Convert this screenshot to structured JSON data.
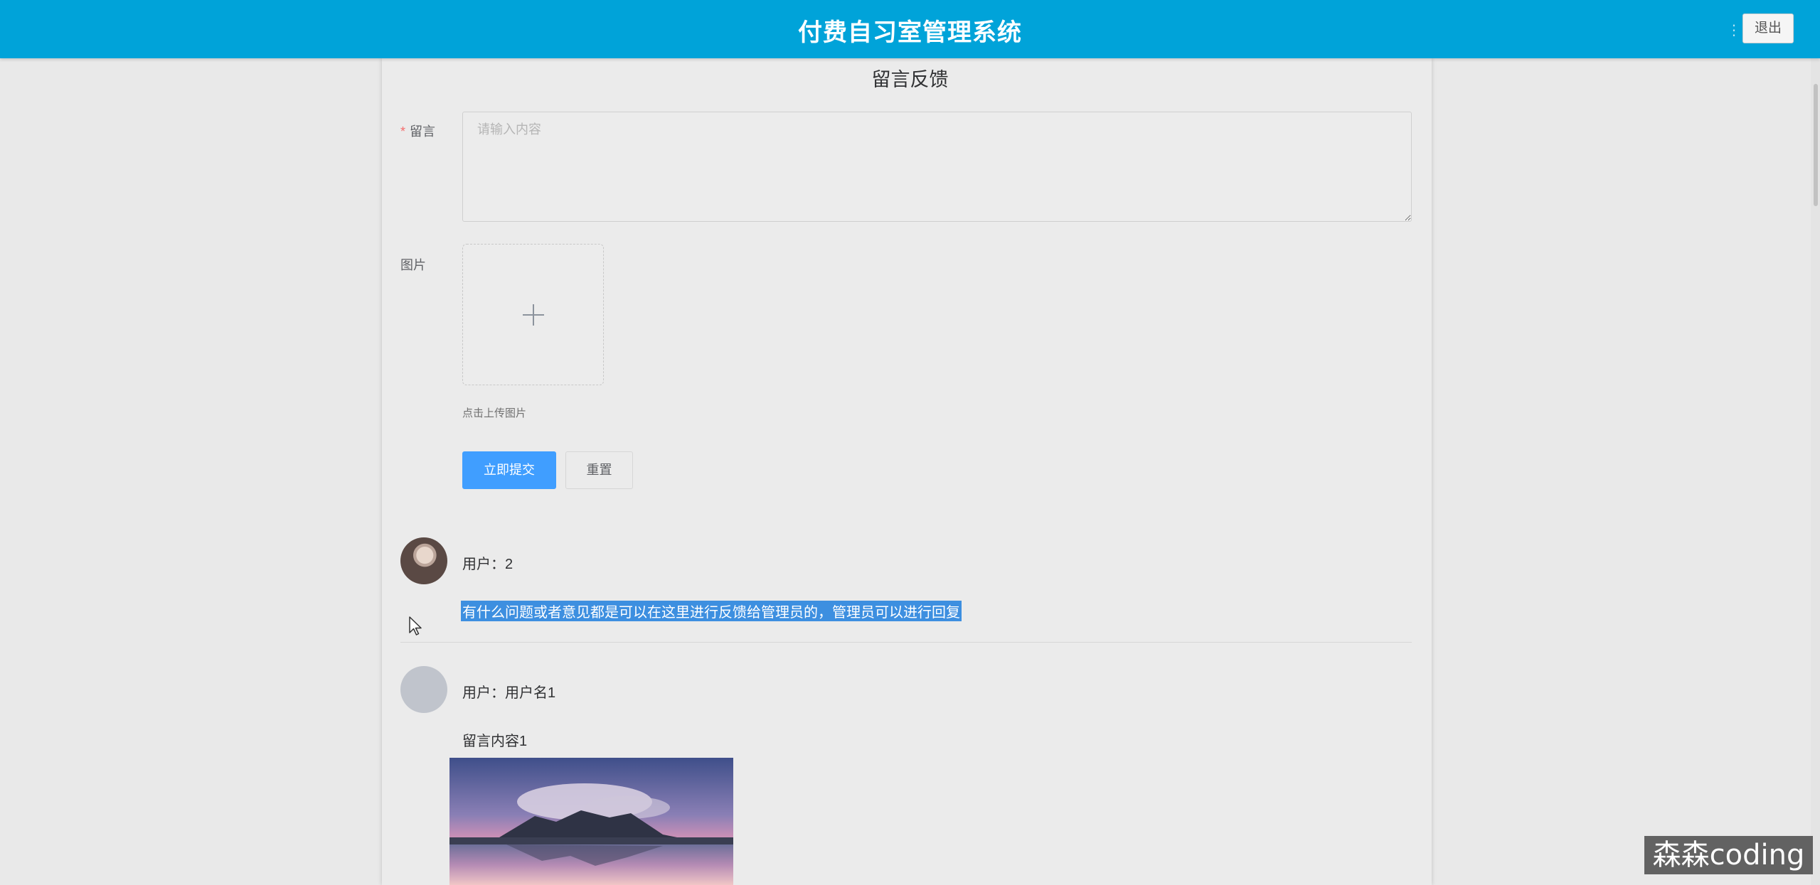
{
  "header": {
    "title": "付费自习室管理系统",
    "logout_label": "退出",
    "menu_dot": "⋮"
  },
  "form": {
    "title": "留言反馈",
    "message_label": "留言",
    "required_mark": "*",
    "message_placeholder": "请输入内容",
    "message_value": "",
    "image_label": "图片",
    "upload_hint": "点击上传图片",
    "submit_label": "立即提交",
    "reset_label": "重置"
  },
  "comments": [
    {
      "user": "用户：2",
      "text": "有什么问题或者意见都是可以在这里进行反馈给管理员的，管理员可以进行回复",
      "selected": true,
      "avatar": "photo"
    },
    {
      "user": "用户：用户名1",
      "text": "留言内容1",
      "avatar": "placeholder",
      "image": "mountain-lake-landscape"
    }
  ],
  "watermark": "森森coding"
}
